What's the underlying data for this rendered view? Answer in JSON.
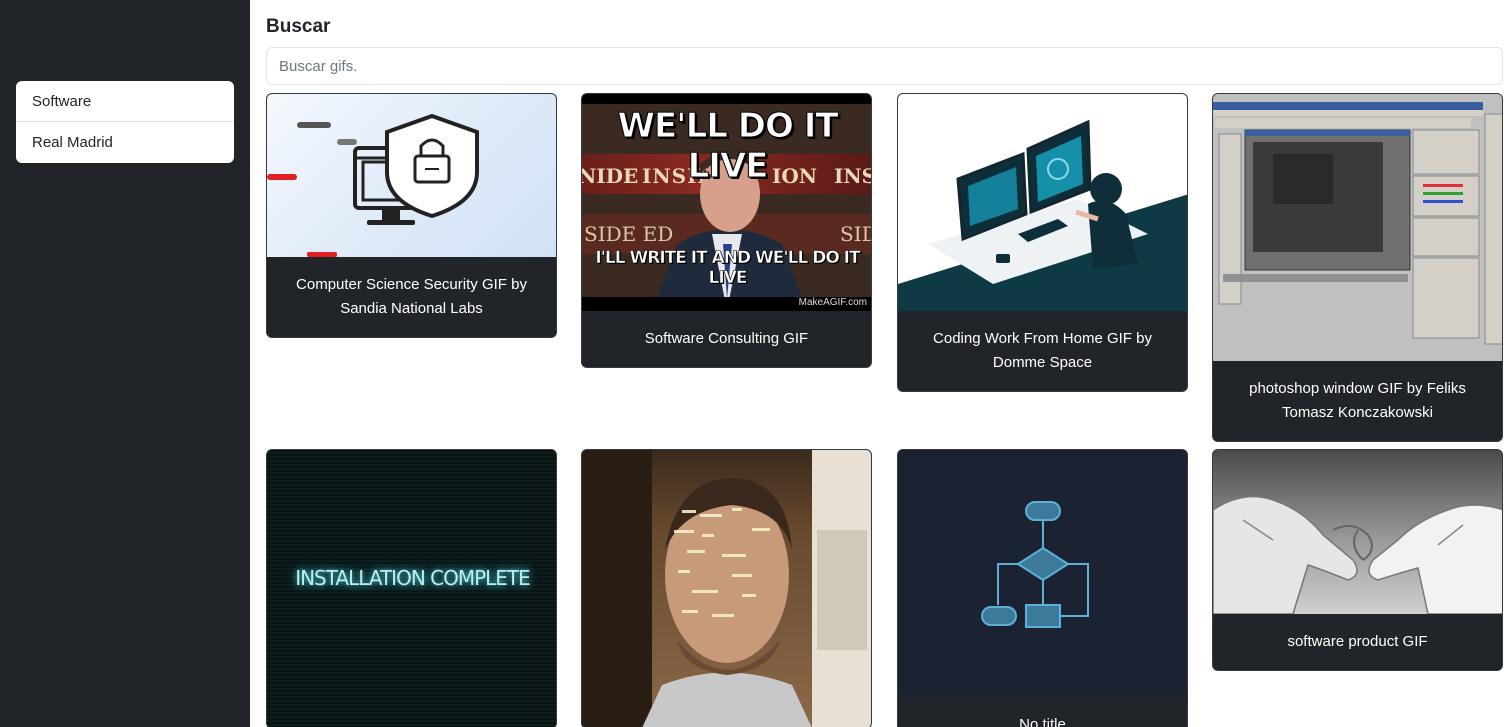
{
  "sidebar": {
    "history": [
      {
        "label": "Software"
      },
      {
        "label": "Real Madrid"
      }
    ]
  },
  "search": {
    "title": "Buscar",
    "placeholder": "Buscar gifs."
  },
  "gifs": [
    {
      "title": "Computer Science Security GIF by Sandia National Labs"
    },
    {
      "title": "Software Consulting GIF",
      "top_text": "WE'LL DO IT LIVE",
      "bottom_text": "I'LL WRITE IT AND WE'LL DO IT LIVE",
      "watermark": "MakeAGIF.com",
      "banner_left": "INSIDE",
      "banner_right": "ION",
      "banner_far": "INSII",
      "side_left": "SIDE ED",
      "side_right": "SID",
      "side_edge": "NIDE"
    },
    {
      "title": "Coding Work From Home GIF by Domme Space"
    },
    {
      "title": "photoshop window GIF by Feliks Tomasz Konczakowski"
    },
    {
      "title": "",
      "overlay_text": "INSTALLATION COMPLETE"
    },
    {
      "title": ""
    },
    {
      "title": "No title"
    },
    {
      "title": "software product GIF"
    }
  ],
  "colors": {
    "sidebar_bg": "#212529",
    "card_bg": "#212529",
    "accent_teal": "#0d3a45"
  }
}
